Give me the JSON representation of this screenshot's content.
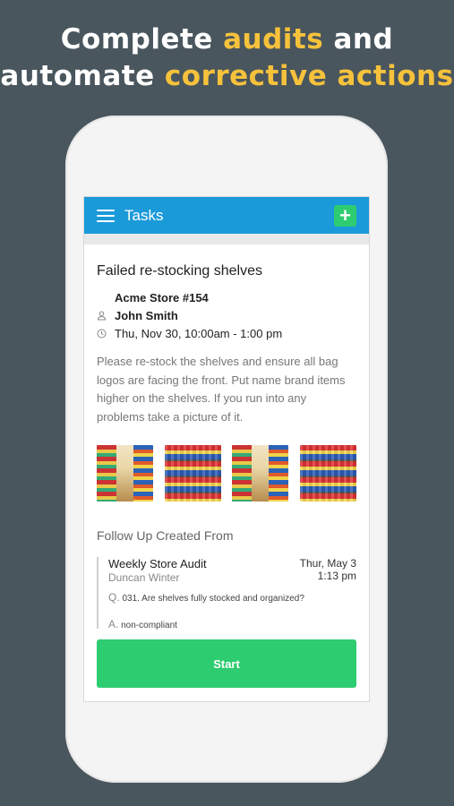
{
  "headline": {
    "line1_a": "Complete ",
    "line1_b": "audits",
    "line1_c": " and",
    "line2_a": "automate ",
    "line2_b": "corrective actions"
  },
  "colors": {
    "accent": "#f6c23b",
    "appbar": "#1a9ad9",
    "green": "#2ecc71",
    "background": "#4a565e"
  },
  "appbar": {
    "title": "Tasks",
    "add_label": "+"
  },
  "task": {
    "title": "Failed re-stocking shelves",
    "store": "Acme Store #154",
    "assignee": "John Smith",
    "datetime": "Thu, Nov 30, 10:00am - 1:00 pm",
    "description": "Please re-stock the shelves and ensure all bag logos are facing the front. Put name brand items higher on the shelves. If you run into any problems take a picture of it."
  },
  "photos": [
    "store-aisle-photo",
    "shelf-snacks-photo",
    "store-aisle-photo",
    "shelf-snacks-photo"
  ],
  "followup": {
    "section_title": "Follow Up Created From",
    "audit_name": "Weekly Store Audit",
    "author": "Duncan Winter",
    "date_line1": "Thur, May 3",
    "date_line2": "1:13 pm",
    "q_prefix": "Q.",
    "question": "031. Are shelves fully stocked and organized?",
    "a_prefix": "A.",
    "answer": "non-compliant"
  },
  "start_label": "Start"
}
